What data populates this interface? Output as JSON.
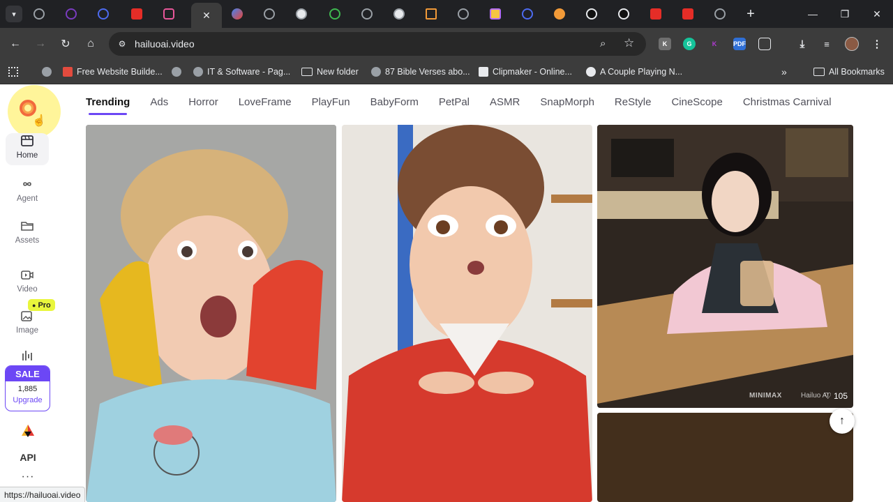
{
  "browser": {
    "url": "hailuoai.video",
    "status_url": "https://hailuoai.video",
    "bookmarks": [
      {
        "label": "Free Website Builde...",
        "icon": "builder-icon"
      },
      {
        "label": "IT & Software - Pag...",
        "icon": "globe-icon"
      },
      {
        "label": "New folder",
        "icon": "folder-icon"
      },
      {
        "label": "87 Bible Verses abo...",
        "icon": "globe-icon"
      },
      {
        "label": "Clipmaker - Online...",
        "icon": "clipmaker-icon"
      },
      {
        "label": "A Couple Playing N...",
        "icon": "page-icon"
      }
    ],
    "all_bookmarks": "All Bookmarks",
    "bookmarks_overflow": "»"
  },
  "sidebar": {
    "items": [
      {
        "label": "Home",
        "icon": "home-icon"
      },
      {
        "label": "Agent",
        "icon": "infinity-icon"
      },
      {
        "label": "Assets",
        "icon": "folder-icon"
      },
      {
        "label": "Video",
        "icon": "video-icon"
      },
      {
        "label": "Image",
        "icon": "image-icon"
      }
    ],
    "pro_badge": "Pro",
    "sale": {
      "label": "SALE",
      "count": "1,885",
      "upgrade": "Upgrade"
    },
    "api_label": "API",
    "more": "···"
  },
  "categories": [
    "Trending",
    "Ads",
    "Horror",
    "LoveFrame",
    "PlayFun",
    "BabyForm",
    "PetPal",
    "ASMR",
    "SnapMorph",
    "ReStyle",
    "CineScope",
    "Christmas Carnival"
  ],
  "cards": [
    {
      "likes": "105",
      "watermark": "MINIMAX",
      "watermark2": "Hailuo AI"
    }
  ],
  "colors": {
    "accent": "#6c47f5",
    "pro_badge": "#e9f63c"
  }
}
